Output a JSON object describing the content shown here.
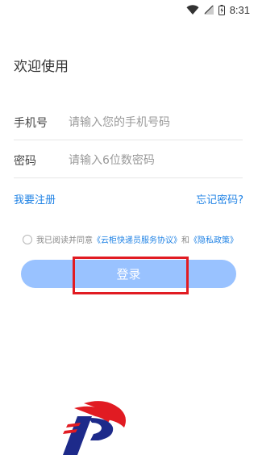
{
  "status_bar": {
    "time": "8:31",
    "icons": [
      "wifi-icon",
      "signal-icon",
      "battery-icon"
    ]
  },
  "screen": {
    "title": "欢迎使用"
  },
  "form": {
    "phone": {
      "label": "手机号",
      "placeholder": "请输入您的手机号码",
      "value": ""
    },
    "password": {
      "label": "密码",
      "placeholder": "请输入6位数密码",
      "value": ""
    }
  },
  "links": {
    "register": "我要注册",
    "forgot_password": "忘记密码?"
  },
  "agreement": {
    "checked": false,
    "prefix": "我已阅读并同意",
    "terms_link": "《云柜快递员服务协议》",
    "and": "和",
    "privacy_link": "《隐私政策》"
  },
  "login_button": {
    "label": "登录"
  },
  "colors": {
    "accent": "#1f82e5",
    "button": "#99c2ff",
    "highlight": "#e11b22",
    "logo_red": "#e11b22",
    "logo_navy": "#1d2a8a"
  }
}
